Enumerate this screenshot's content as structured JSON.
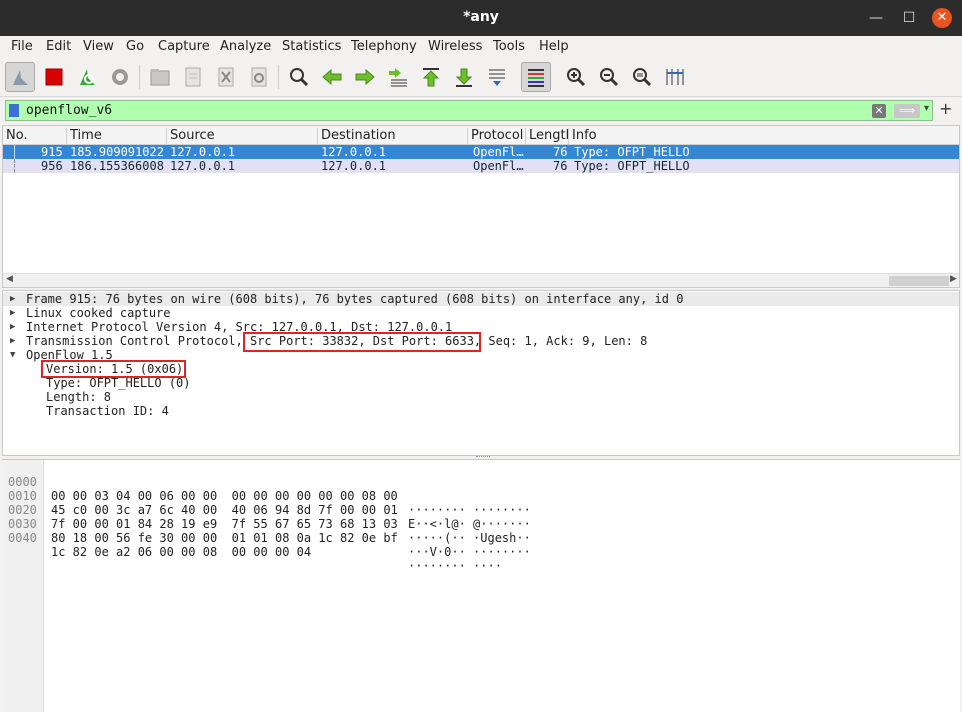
{
  "window": {
    "title": "*any",
    "min_label": "—",
    "max_label": "☐",
    "close_label": "✕"
  },
  "menu": [
    "File",
    "Edit",
    "View",
    "Go",
    "Capture",
    "Analyze",
    "Statistics",
    "Telephony",
    "Wireless",
    "Tools",
    "Help"
  ],
  "toolbar": {
    "icons": [
      "shark-fin-icon",
      "stop-capture-icon",
      "restart-capture-icon",
      "capture-options-icon",
      "open-file-icon",
      "save-file-icon",
      "close-file-icon",
      "reload-file-icon",
      "find-packet-icon",
      "go-back-icon",
      "go-forward-icon",
      "go-to-packet-icon",
      "go-first-icon",
      "go-last-icon",
      "autoscroll-icon",
      "colorize-icon",
      "zoom-in-icon",
      "zoom-out-icon",
      "normal-size-icon",
      "resize-columns-icon"
    ]
  },
  "filter": {
    "value": "openflow_v6",
    "clear_label": "✕",
    "apply_label": "⟹",
    "dropdown_label": "▾",
    "add_label": "+"
  },
  "packet_list": {
    "columns": [
      "No.",
      "Time",
      "Source",
      "Destination",
      "Protocol",
      "Length",
      "Info"
    ],
    "rows": [
      {
        "no": "915",
        "time": "185.909091022",
        "source": "127.0.0.1",
        "destination": "127.0.0.1",
        "protocol": "OpenFl…",
        "length": "76",
        "info": "Type: OFPT_HELLO",
        "selected": true
      },
      {
        "no": "956",
        "time": "186.155366008",
        "source": "127.0.0.1",
        "destination": "127.0.0.1",
        "protocol": "OpenFl…",
        "length": "76",
        "info": "Type: OFPT_HELLO",
        "selected": false
      }
    ]
  },
  "details": {
    "frame": "Frame 915: 76 bytes on wire (608 bits), 76 bytes captured (608 bits) on interface any, id 0",
    "linux": "Linux cooked capture",
    "ip": "Internet Protocol Version 4, Src: 127.0.0.1, Dst: 127.0.0.1",
    "tcp_prefix": "Transmission Control Protocol, ",
    "tcp_ports": "Src Port: 33832, Dst Port: 6633,",
    "tcp_suffix": " Seq: 1, Ack: 9, Len: 8",
    "openflow": "OpenFlow 1.5",
    "version": "Version: 1.5 (0x06)",
    "type": "Type: OFPT_HELLO (0)",
    "length": "Length: 8",
    "xid": "Transaction ID: 4"
  },
  "hex": [
    {
      "offset": "0000",
      "bytes": "00 00 03 04 00 06 00 00  00 00 00 00 00 00 08 00",
      "ascii": "········ ········"
    },
    {
      "offset": "0010",
      "bytes": "45 c0 00 3c a7 6c 40 00  40 06 94 8d 7f 00 00 01",
      "ascii": "E··<·l@· @·······"
    },
    {
      "offset": "0020",
      "bytes": "7f 00 00 01 84 28 19 e9  7f 55 67 65 73 68 13 03",
      "ascii": "·····(·· ·Ugesh··"
    },
    {
      "offset": "0030",
      "bytes": "80 18 00 56 fe 30 00 00  01 01 08 0a 1c 82 0e bf",
      "ascii": "···V·0·· ········"
    },
    {
      "offset": "0040",
      "bytes": "1c 82 0e a2 06 00 00 08  00 00 00 04",
      "ascii": "········ ····"
    }
  ]
}
